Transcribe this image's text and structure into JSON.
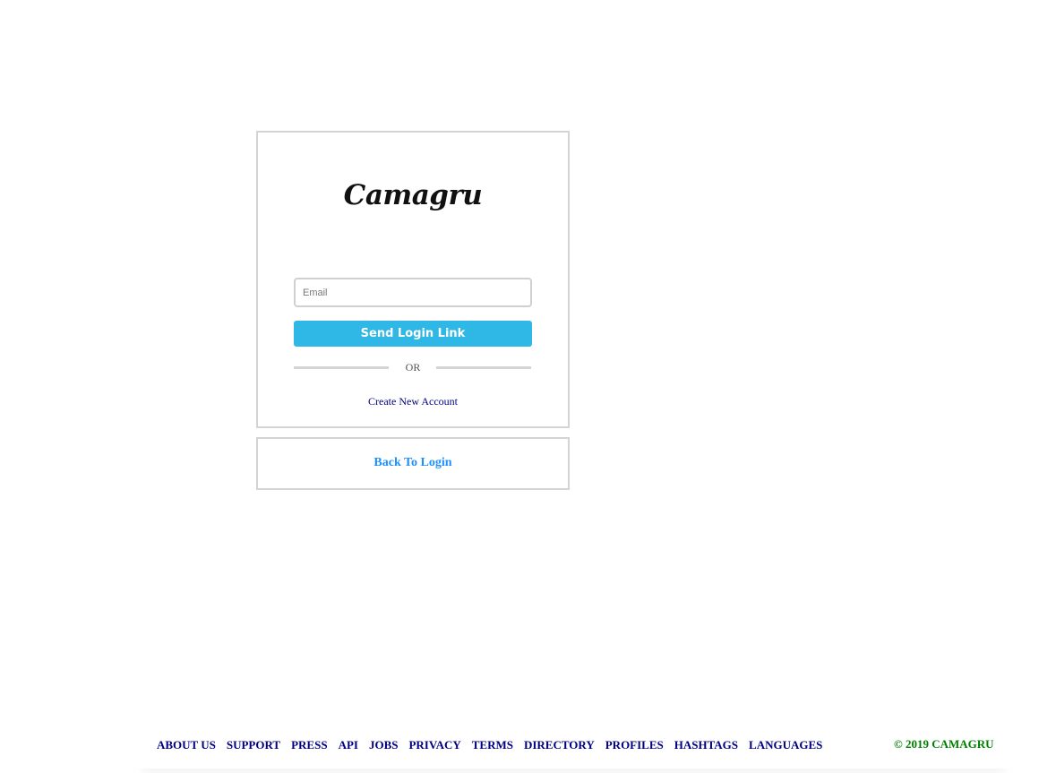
{
  "brand": {
    "logo_text": "Camagru"
  },
  "form": {
    "email_placeholder": "Email",
    "email_value": "",
    "submit_label": "Send Login Link",
    "divider_text": "OR",
    "create_account_label": "Create New Account"
  },
  "back": {
    "label": "Back To Login"
  },
  "footer": {
    "links": [
      "ABOUT US",
      "SUPPORT",
      "PRESS",
      "API",
      "JOBS",
      "PRIVACY",
      "TERMS",
      "DIRECTORY",
      "PROFILES",
      "HASHTAGS",
      "LANGUAGES"
    ],
    "copyright": "© 2019 CAMAGRU"
  },
  "colors": {
    "button_bg": "#2fb8e6",
    "link_navy": "#000080",
    "back_link": "#1e90ff",
    "copyright": "#008000",
    "border": "#d4d4d4"
  }
}
